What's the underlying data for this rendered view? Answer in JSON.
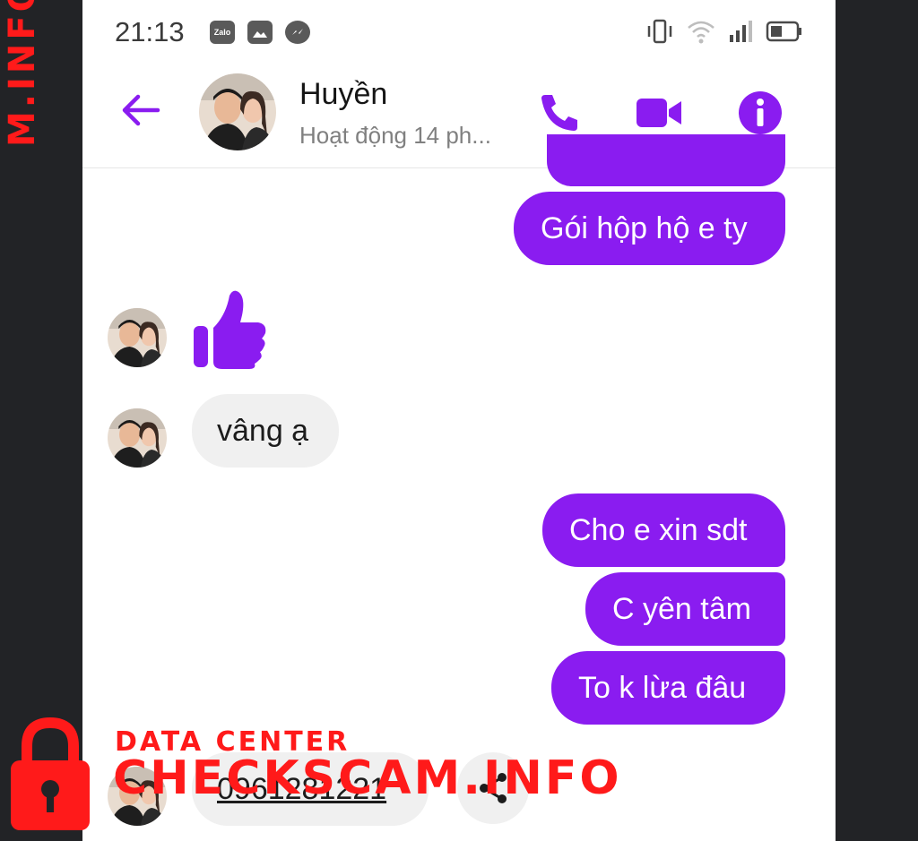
{
  "status_bar": {
    "time": "21:13",
    "app_icons": [
      "zalo-icon",
      "gallery-icon",
      "messenger-icon"
    ],
    "zalo_label": "Zalo"
  },
  "header": {
    "contact_name": "Huyền",
    "contact_status": "Hoạt động 14 ph..."
  },
  "messages": [
    {
      "from": "me",
      "text": "Gói hộp hộ e ty"
    },
    {
      "from": "them",
      "type": "like",
      "text": ""
    },
    {
      "from": "them",
      "text": "vâng ạ"
    },
    {
      "from": "me",
      "text": "Cho e xin sdt"
    },
    {
      "from": "me",
      "text": "C yên tâm"
    },
    {
      "from": "me",
      "text": "To k lừa đâu"
    },
    {
      "from": "them",
      "text": "0961281221"
    }
  ],
  "watermark": {
    "vertical": "M.INFO",
    "small": "DATA CENTER",
    "big": "CHECKSCAM.INFO"
  },
  "colors": {
    "accent": "#8a1cf0",
    "incoming_bubble": "#f0f0f0",
    "watermark": "#ff1a1a",
    "background": "#222326"
  }
}
